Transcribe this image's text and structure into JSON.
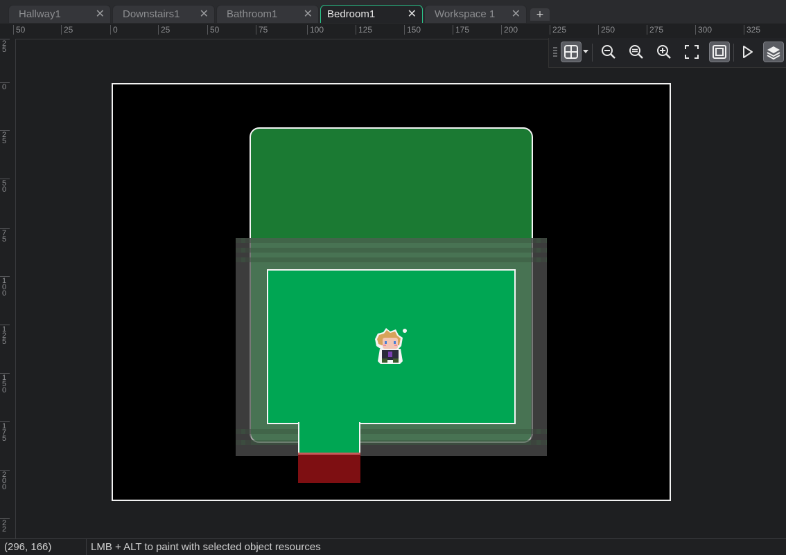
{
  "tabs": [
    {
      "label": "Hallway1",
      "active": false
    },
    {
      "label": "Downstairs1",
      "active": false
    },
    {
      "label": "Bathroom1",
      "active": false
    },
    {
      "label": "Bedroom1",
      "active": true
    },
    {
      "label": "Workspace 1",
      "active": false
    }
  ],
  "tab_close_glyph": "✕",
  "tab_add_glyph": "+",
  "ruler_top": [
    "50",
    "25",
    "0",
    "25",
    "50",
    "75",
    "100",
    "125",
    "150",
    "175",
    "200",
    "225",
    "250",
    "275",
    "300",
    "325"
  ],
  "ruler_left": [
    "2\n5",
    "0",
    "2\n5",
    "5\n0",
    "7\n5",
    "1\n0\n0",
    "1\n2\n5",
    "1\n5\n0",
    "1\n7\n5",
    "2\n0\n0",
    "2\n2"
  ],
  "toolbar": {
    "grid_icon": "grid-icon",
    "zoom_out_icon": "zoom-out-icon",
    "zoom_reset_icon": "zoom-reset-icon",
    "zoom_in_icon": "zoom-in-icon",
    "fullscreen_icon": "fullscreen-icon",
    "frame_icon": "frame-icon",
    "play_icon": "play-icon",
    "layers_icon": "layers-icon"
  },
  "status": {
    "coords": "(296, 166)",
    "hint": "LMB + ALT to paint with selected object resources"
  },
  "colors": {
    "accent": "#2bc48a",
    "room_wall": "#1b7a33",
    "floor": "#00a653",
    "exit_door": "#7e0f12"
  }
}
